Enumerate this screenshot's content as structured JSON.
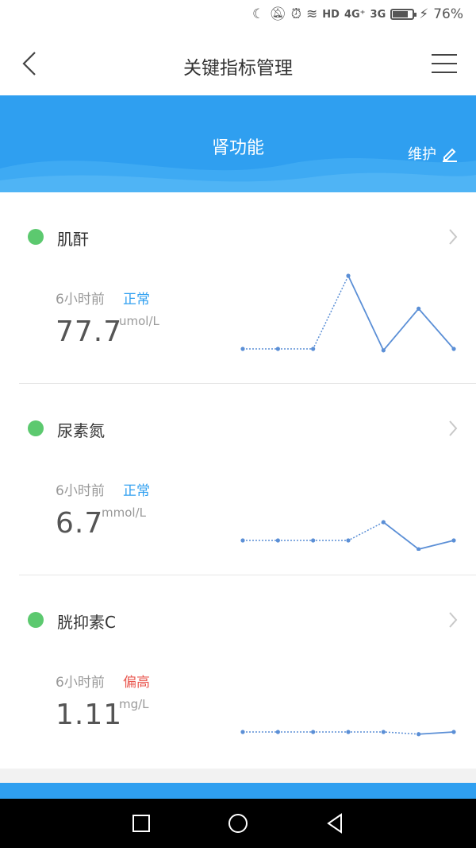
{
  "status_bar": {
    "network_hd": "HD",
    "network_4g": "4G⁺",
    "network_3g": "3G",
    "battery": "76%",
    "battery_level": 0.76
  },
  "nav": {
    "title": "关键指标管理"
  },
  "banner": {
    "title": "肾功能",
    "maintain_label": "维护"
  },
  "indicators": [
    {
      "name": "肌酐",
      "time": "6小时前",
      "status": "正常",
      "status_type": "normal",
      "value": "77.7",
      "unit": "umol/L",
      "trend": [
        0.0,
        0.0,
        0.0,
        1.0,
        -0.02,
        0.55,
        0.0
      ]
    },
    {
      "name": "尿素氮",
      "time": "6小时前",
      "status": "正常",
      "status_type": "normal",
      "value": "6.7",
      "unit": "mmol/L",
      "trend": [
        0.0,
        0.0,
        0.0,
        0.0,
        0.25,
        -0.12,
        0.0
      ]
    },
    {
      "name": "胱抑素C",
      "time": "6小时前",
      "status": "偏高",
      "status_type": "high",
      "value": "1.11",
      "unit": "mg/L",
      "trend": [
        0.0,
        0.0,
        0.0,
        0.0,
        0.0,
        -0.03,
        0.0
      ]
    }
  ],
  "colors": {
    "accent": "#2f9ff0",
    "normal": "#2f9ff0",
    "high": "#e9574f",
    "dot": "#5cc96f",
    "trend_line": "#5b8fd6"
  }
}
